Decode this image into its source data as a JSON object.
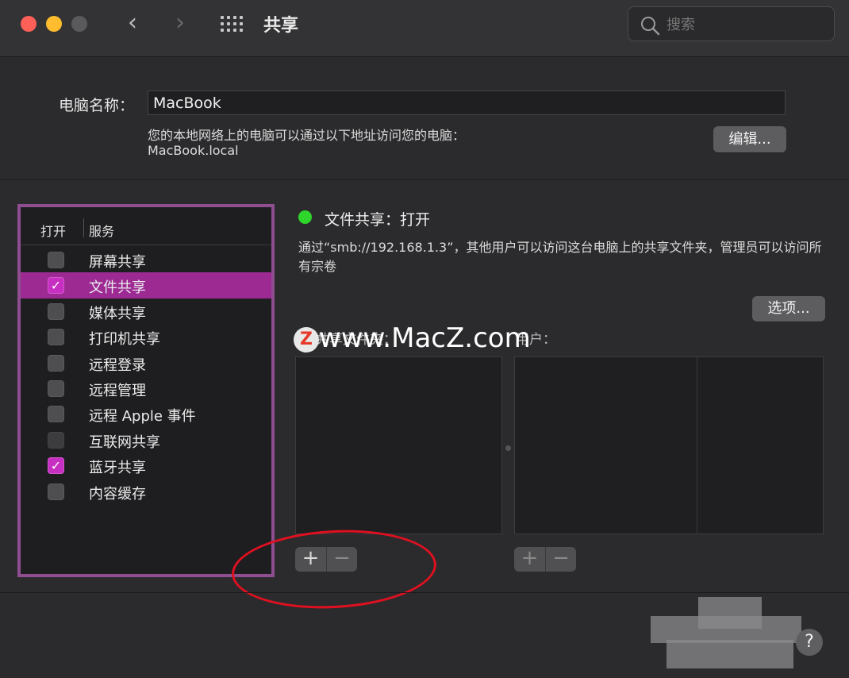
{
  "window": {
    "title": "共享",
    "search_placeholder": "搜索"
  },
  "computer": {
    "label": "电脑名称：",
    "name": "MacBook",
    "address_desc": "您的本地网络上的电脑可以通过以下地址访问您的电脑：",
    "address_host": "MacBook.local",
    "edit_label": "编辑..."
  },
  "services": {
    "col_on": "打开",
    "col_service": "服务",
    "items": [
      {
        "label": "屏幕共享",
        "checked": false
      },
      {
        "label": "文件共享",
        "checked": true,
        "selected": true
      },
      {
        "label": "媒体共享",
        "checked": false
      },
      {
        "label": "打印机共享",
        "checked": false
      },
      {
        "label": "远程登录",
        "checked": false
      },
      {
        "label": "远程管理",
        "checked": false
      },
      {
        "label": "远程 Apple 事件",
        "checked": false
      },
      {
        "label": "互联网共享",
        "checked": false,
        "disabled": true
      },
      {
        "label": "蓝牙共享",
        "checked": true
      },
      {
        "label": "内容缓存",
        "checked": false
      }
    ]
  },
  "detail": {
    "status_title": "文件共享：打开",
    "status_color": "#2ed52a",
    "status_desc": "通过“smb://192.168.1.3”，其他用户可以访问这台电脑上的共享文件夹，管理员可以访问所有宗卷",
    "options_label": "选项...",
    "folders_label": "共享文件夹：",
    "users_label": "用户：",
    "plus": "+",
    "minus": "−"
  },
  "watermark": {
    "logo": "Z",
    "text": "www.MacZ.com"
  },
  "help": "?",
  "colors": {
    "accent": "#9d2a93",
    "highlight_border": "#8e4e90",
    "annotation": "#e01020"
  }
}
